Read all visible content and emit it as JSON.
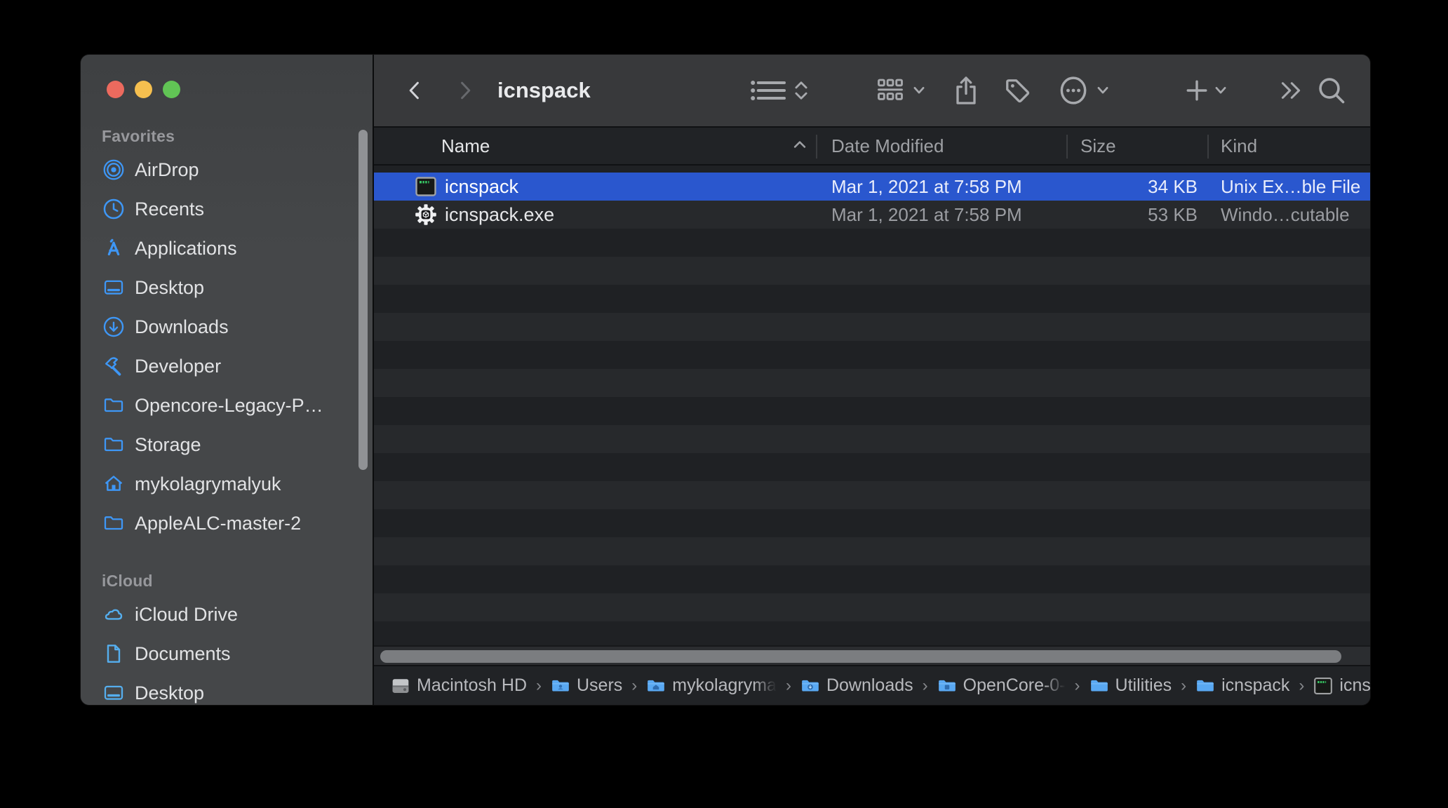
{
  "window": {
    "title": "icnspack",
    "traffic_lights": {
      "close": "#EC6A5E",
      "minimize": "#F5BF4F",
      "zoom": "#61C455"
    }
  },
  "toolbar": {
    "title": "icnspack",
    "icons": [
      "back-icon",
      "forward-icon",
      "list-view-icon",
      "view-updown-icon",
      "group-icon",
      "share-icon",
      "tag-icon",
      "more-icon",
      "add-icon",
      "overflow-icon",
      "search-icon"
    ]
  },
  "sidebar": {
    "sections": [
      {
        "title": "Favorites",
        "items": [
          {
            "label": "AirDrop",
            "icon": "airdrop-icon"
          },
          {
            "label": "Recents",
            "icon": "recents-icon"
          },
          {
            "label": "Applications",
            "icon": "applications-icon"
          },
          {
            "label": "Desktop",
            "icon": "desktop-icon"
          },
          {
            "label": "Downloads",
            "icon": "downloads-icon"
          },
          {
            "label": "Developer",
            "icon": "hammer-icon"
          },
          {
            "label": "Opencore-Legacy-P…",
            "icon": "folder-icon"
          },
          {
            "label": "Storage",
            "icon": "folder-icon"
          },
          {
            "label": "mykolagrymalyuk",
            "icon": "home-icon"
          },
          {
            "label": "AppleALC-master-2",
            "icon": "folder-icon"
          }
        ]
      },
      {
        "title": "iCloud",
        "items": [
          {
            "label": "iCloud Drive",
            "icon": "cloud-icon"
          },
          {
            "label": "Documents",
            "icon": "document-icon"
          },
          {
            "label": "Desktop",
            "icon": "desktop-icon"
          }
        ]
      }
    ]
  },
  "list": {
    "columns": [
      {
        "label": "Name",
        "sorted": "ascending"
      },
      {
        "label": "Date Modified"
      },
      {
        "label": "Size"
      },
      {
        "label": "Kind"
      }
    ],
    "rows": [
      {
        "name": "icnspack",
        "icon": "unix-executable-icon",
        "date_modified": "Mar 1, 2021 at 7:58 PM",
        "size": "34 KB",
        "kind": "Unix Ex…ble File",
        "selected": true
      },
      {
        "name": "icnspack.exe",
        "icon": "windows-executable-icon",
        "date_modified": "Mar 1, 2021 at 7:58 PM",
        "size": "53 KB",
        "kind": "Windo…cutable",
        "selected": false
      }
    ]
  },
  "path_bar": {
    "separator": "›",
    "segments": [
      {
        "label": "Macintosh HD",
        "icon": "hard-drive-icon"
      },
      {
        "label": "Users",
        "icon": "folder-icon"
      },
      {
        "label": "mykolagryma",
        "icon": "folder-home-icon",
        "truncated": true
      },
      {
        "label": "Downloads",
        "icon": "folder-download-icon"
      },
      {
        "label": "OpenCore-0-",
        "icon": "folder-icon",
        "truncated": true
      },
      {
        "label": "Utilities",
        "icon": "folder-icon"
      },
      {
        "label": "icnspack",
        "icon": "folder-icon"
      },
      {
        "label": "icnspack",
        "icon": "unix-executable-icon"
      }
    ]
  },
  "colors": {
    "selection_blue": "#2A57CE",
    "sidebar_icon_blue": "#3E97F6",
    "icloud_icon_blue": "#55AEEE",
    "row_stripe_dark": "#1F2124",
    "row_stripe_light": "#27292C"
  }
}
